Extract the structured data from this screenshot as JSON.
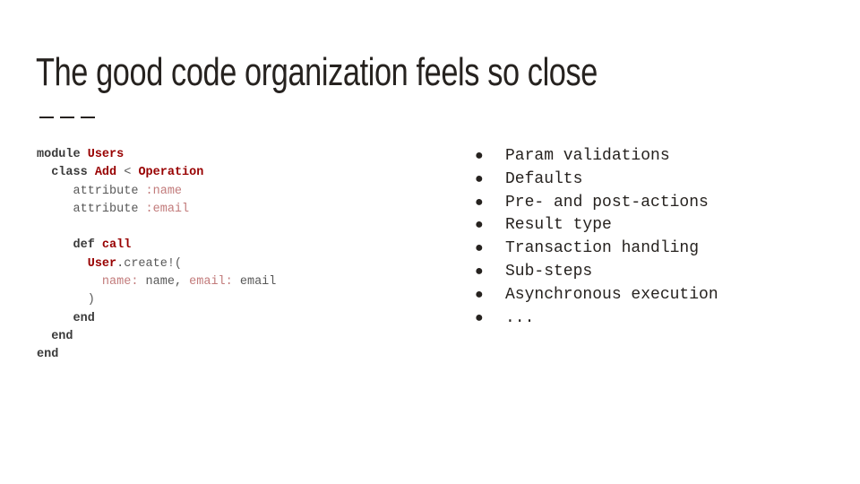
{
  "slide": {
    "title": "The good code organization feels so close"
  },
  "code": {
    "lines": [
      [
        {
          "t": "module ",
          "c": "kw"
        },
        {
          "t": "Users",
          "c": "cn"
        }
      ],
      [
        {
          "t": "  class ",
          "c": "kw"
        },
        {
          "t": "Add",
          "c": "cn"
        },
        {
          "t": " < ",
          "c": "pl"
        },
        {
          "t": "Operation",
          "c": "cn"
        }
      ],
      [
        {
          "t": "     attribute ",
          "c": "pl"
        },
        {
          "t": ":name",
          "c": "sy"
        }
      ],
      [
        {
          "t": "     attribute ",
          "c": "pl"
        },
        {
          "t": ":email",
          "c": "sy"
        }
      ],
      [],
      [
        {
          "t": "     def ",
          "c": "kw"
        },
        {
          "t": "call",
          "c": "cn"
        }
      ],
      [
        {
          "t": "       ",
          "c": "pl"
        },
        {
          "t": "User",
          "c": "cn"
        },
        {
          "t": ".create!(",
          "c": "pl"
        }
      ],
      [
        {
          "t": "         ",
          "c": "pl"
        },
        {
          "t": "name:",
          "c": "sy"
        },
        {
          "t": " name, ",
          "c": "pl"
        },
        {
          "t": "email:",
          "c": "sy"
        },
        {
          "t": " email",
          "c": "pl"
        }
      ],
      [
        {
          "t": "       )",
          "c": "pl"
        }
      ],
      [
        {
          "t": "     end",
          "c": "kw"
        }
      ],
      [
        {
          "t": "  end",
          "c": "kw"
        }
      ],
      [
        {
          "t": "end",
          "c": "kw"
        }
      ]
    ]
  },
  "bullets": {
    "marker": "●",
    "items": [
      "Param validations",
      "Defaults",
      "Pre- and post-actions",
      "Result type",
      "Transaction handling",
      "Sub-steps",
      "Asynchronous execution",
      "..."
    ]
  },
  "colors": {
    "keyword": "#3a3a3a",
    "constant": "#980000",
    "symbol": "#c27b7b",
    "text": "#26221f"
  }
}
